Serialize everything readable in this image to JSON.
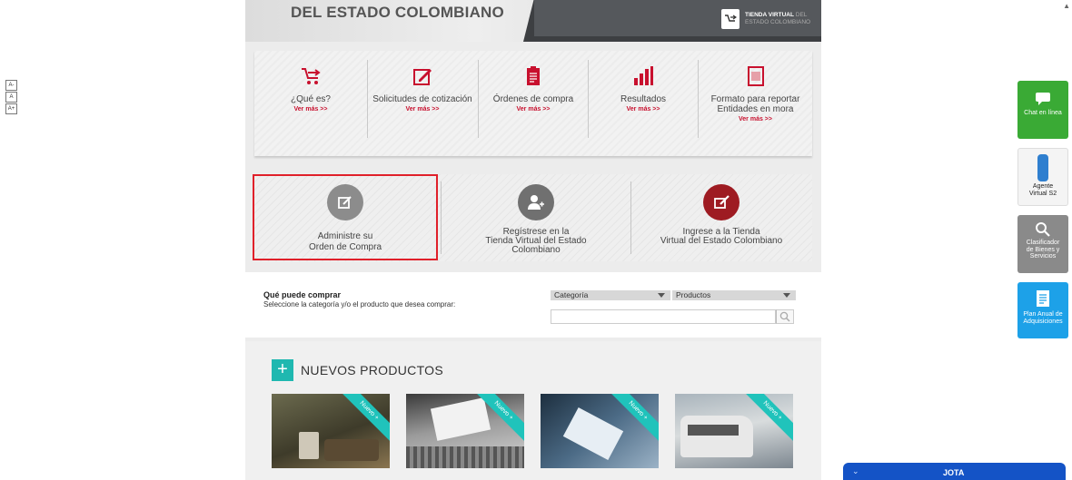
{
  "font_tools": [
    "A-",
    "A",
    "A+"
  ],
  "banner": {
    "title": "DEL ESTADO COLOMBIANO",
    "logo_line1": "TIENDA VIRTUAL",
    "logo_line1_suffix": "DEL",
    "logo_line2": "ESTADO COLOMBIANO"
  },
  "menu": {
    "items": [
      {
        "label": "¿Qué es?",
        "more": "Ver más >>",
        "icon": "cart-arrow-icon"
      },
      {
        "label": "Solicitudes de cotización",
        "more": "Ver más >>",
        "icon": "form-pen-icon"
      },
      {
        "label": "Órdenes de compra",
        "more": "Ver más >>",
        "icon": "clipboard-icon"
      },
      {
        "label": "Resultados",
        "more": "Ver más >>",
        "icon": "bar-chart-icon"
      },
      {
        "label": "Formato para reportar",
        "label2": "Entidades en mora",
        "more": "Ver más >>",
        "icon": "document-icon"
      }
    ]
  },
  "actions": [
    {
      "line1": "Administre su",
      "line2": "Orden de Compra",
      "line3": "",
      "color": "#8c8c8c"
    },
    {
      "line1": "Regístrese en la",
      "line2": "Tienda Virtual del Estado",
      "line3": "Colombiano",
      "color": "#707070"
    },
    {
      "line1": "Ingrese a la Tienda",
      "line2": "Virtual del Estado Colombiano",
      "line3": "",
      "color": "#9e1b22"
    }
  ],
  "buy": {
    "title": "Qué puede comprar",
    "subtitle": "Seleccione la categoría y/o el producto que desea comprar:",
    "category": "Categoría",
    "products": "Productos",
    "search_placeholder": ""
  },
  "new_products": {
    "title": "NUEVOS PRODUCTOS",
    "badge": "Nuevo",
    "items": [
      "Nuevo +",
      "Nuevo +",
      "Nuevo +",
      "Nuevo +"
    ]
  },
  "side": {
    "chat": "Chat en línea",
    "agent_line1": "Agente",
    "agent_line2": "Virtual S2",
    "classifier_line1": "Clasificador",
    "classifier_line2": "de Bienes y",
    "classifier_line3": "Servicios",
    "plan_line1": "Plan Anual de",
    "plan_line2": "Adquisiciones"
  },
  "jota": {
    "label": "JOTA"
  },
  "colors": {
    "accent_red": "#c8102e",
    "teal": "#1fb8b0",
    "green": "#3aaa35",
    "blue": "#1da1e8",
    "jota_blue": "#1453c6"
  }
}
